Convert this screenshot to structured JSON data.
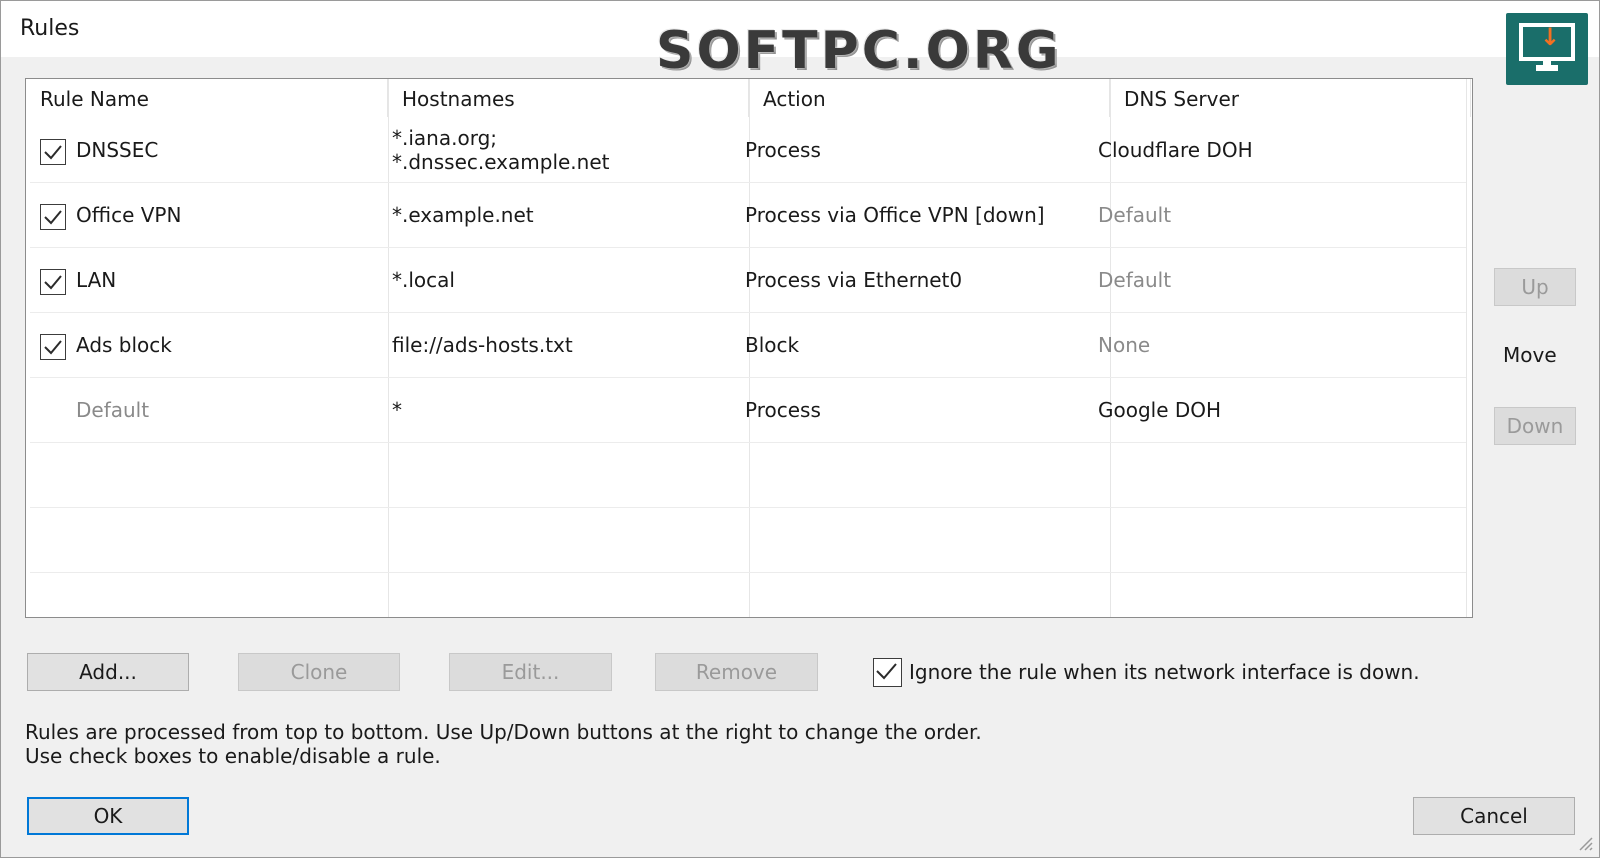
{
  "window": {
    "title": "Rules"
  },
  "watermark": "SOFTPC.ORG",
  "table": {
    "columns": [
      "Rule Name",
      "Hostnames",
      "Action",
      "DNS Server"
    ],
    "rows": [
      {
        "checked": true,
        "name": "DNSSEC",
        "hostnames": [
          "*.iana.org;",
          "*.dnssec.example.net"
        ],
        "action": "Process",
        "dns": "Cloudflare DOH",
        "dns_muted": false,
        "name_muted": false
      },
      {
        "checked": true,
        "name": "Office VPN",
        "hostnames": [
          "*.example.net"
        ],
        "action": "Process via Office VPN [down]",
        "dns": "Default",
        "dns_muted": true,
        "name_muted": false
      },
      {
        "checked": true,
        "name": "LAN",
        "hostnames": [
          "*.local"
        ],
        "action": "Process via Ethernet0",
        "dns": "Default",
        "dns_muted": true,
        "name_muted": false
      },
      {
        "checked": true,
        "name": "Ads block",
        "hostnames": [
          "file://ads-hosts.txt"
        ],
        "action": "Block",
        "dns": "None",
        "dns_muted": true,
        "name_muted": false
      },
      {
        "checked": null,
        "name": "Default",
        "hostnames": [
          "*"
        ],
        "action": "Process",
        "dns": "Google DOH",
        "dns_muted": false,
        "name_muted": true
      }
    ],
    "empty_rows": 3
  },
  "side": {
    "up_label": "Up",
    "move_label": "Move",
    "down_label": "Down"
  },
  "buttons": {
    "add_label": "Add...",
    "clone_label": "Clone",
    "edit_label": "Edit...",
    "remove_label": "Remove",
    "ok_label": "OK",
    "cancel_label": "Cancel"
  },
  "ignore_option": {
    "checked": true,
    "label": "Ignore the rule when its network interface is down."
  },
  "info": {
    "line1": "Rules are processed from top to bottom. Use Up/Down buttons at the right to change the order.",
    "line2": "Use check boxes to enable/disable a rule."
  },
  "colors": {
    "accent": "#0078d7",
    "logo_bg": "#1a6e6a",
    "logo_arrow": "#f37021"
  }
}
